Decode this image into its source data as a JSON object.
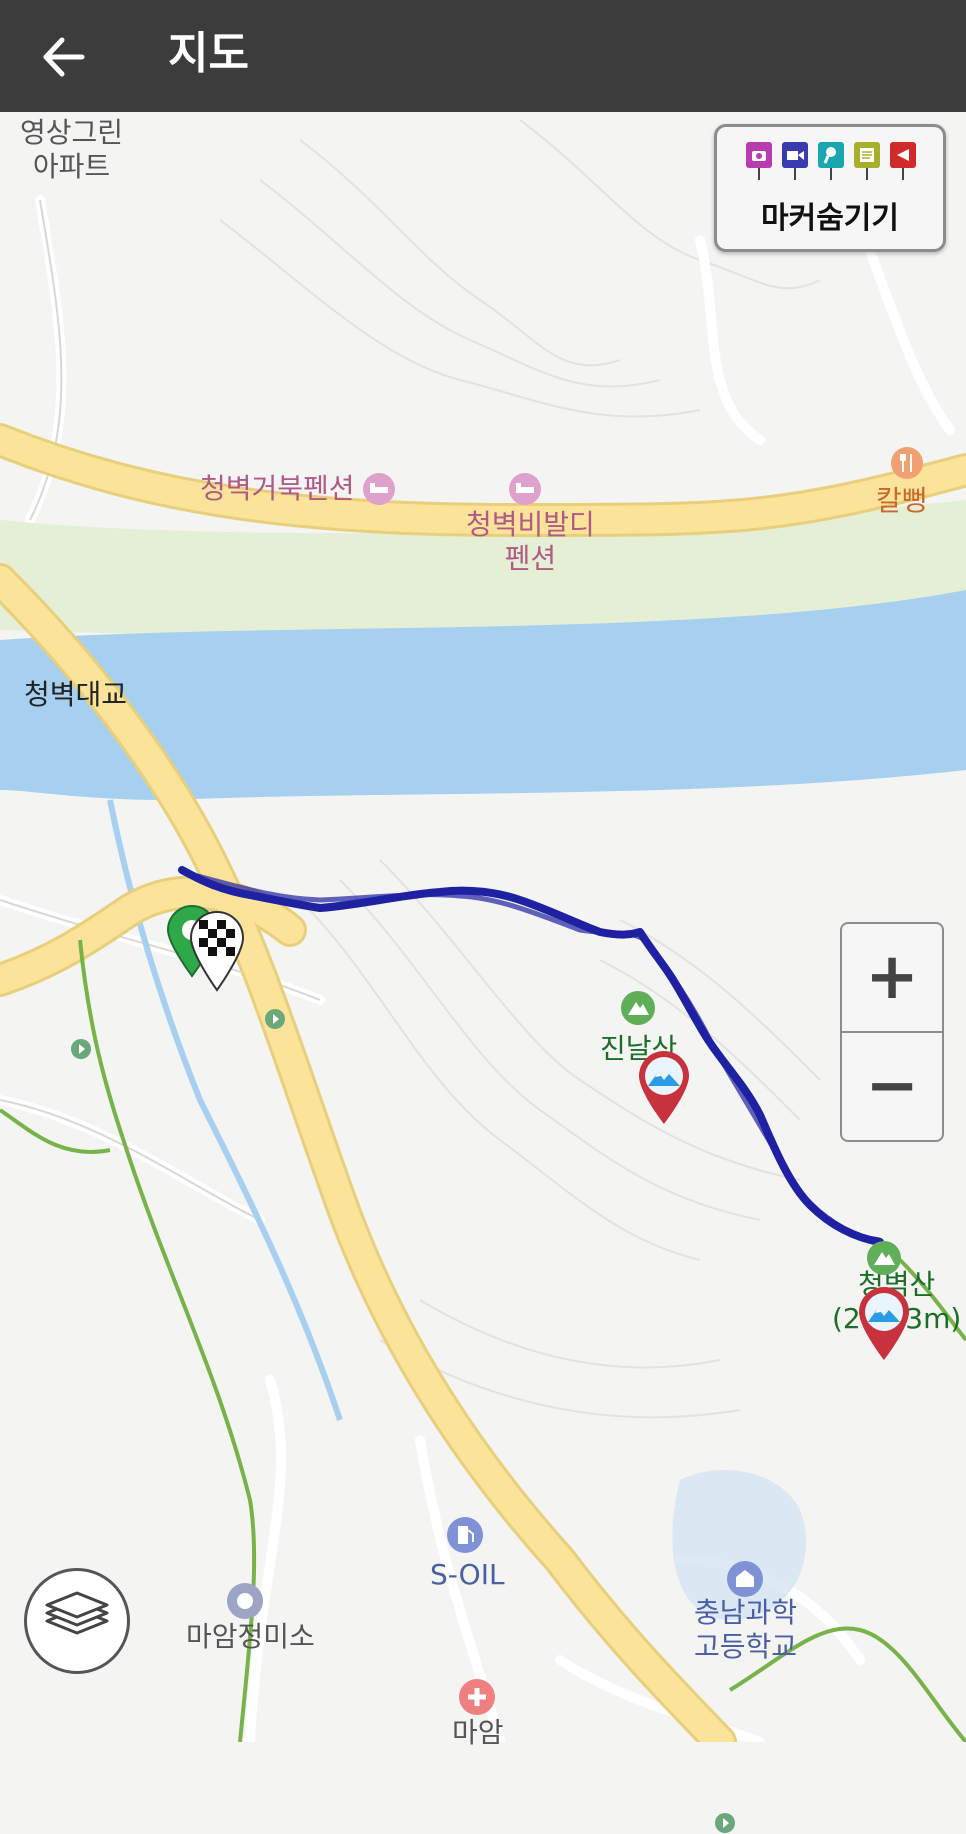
{
  "header": {
    "title": "지도",
    "back_icon": "arrow-left-icon"
  },
  "marker_toggle": {
    "label": "마커숨기기",
    "icons": [
      "camera-icon",
      "video-icon",
      "microphone-icon",
      "memo-icon",
      "flag-icon"
    ],
    "colors": [
      "#b83cb0",
      "#3b3bb0",
      "#1aa6b0",
      "#a8b02a",
      "#d02a2a"
    ]
  },
  "zoom": {
    "in_label": "+",
    "out_label": "−"
  },
  "layers_icon": "layers-icon",
  "colors": {
    "track": "#1f21a3",
    "river": "#a6cff0",
    "main_road": "#fbe39a",
    "trail": "#78b34a",
    "header": "#3c3c3c",
    "start_pin": "#2fa84a",
    "peak_pin": "#c8323c"
  },
  "map_labels": {
    "apt": "영상그린\n아파트",
    "pension1": "청벽거북펜션",
    "pension2": "청벽비발디\n펜션",
    "restaurant": "칼뻥",
    "bridge": "청벽대교",
    "peak1": "진날산",
    "peak2": "청벽산\n(277.3m)",
    "gas": "S-OIL",
    "mill": "마암정미소",
    "school": "충남과학\n고등학교",
    "clinic": "마암"
  }
}
